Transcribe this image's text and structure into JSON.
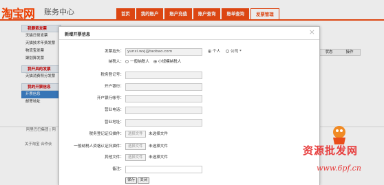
{
  "header": {
    "logo": "淘宝网",
    "subtitle": "账务中心",
    "tabs": [
      "首页",
      "我的账户",
      "账户充值",
      "账户查询",
      "账单查询",
      "发票管理"
    ],
    "active_tab": "发票管理"
  },
  "sidebar": {
    "sections": [
      {
        "title": "我要索发票",
        "items": [
          "天猫日常发票",
          "天猫技术年费发票",
          "物流宝发票",
          "聚划算发票"
        ]
      },
      {
        "title": "我开具的发票",
        "items": [
          "天猫消费积分发票"
        ]
      },
      {
        "title": "我的开票信息",
        "items": [
          "开票信息",
          "邮寄地址"
        ]
      }
    ],
    "active_item": "开票信息"
  },
  "table": {
    "headers": [
      "状态",
      "操作"
    ]
  },
  "footer": {
    "line1": "阿里巴巴集团 | 阿",
    "line2": "关于淘宝  合作伙"
  },
  "modal": {
    "title": "新增开票信息",
    "close": "×",
    "fields": {
      "invoice_header_label": "发票抬头：",
      "invoice_header_value": "yunxi.wxj@taobao.com",
      "personal_label": "个人",
      "company_label": "公司 *",
      "taxpayer_label": "纳税人：",
      "taxpayer_general": "一般纳税人",
      "taxpayer_small": "小规模纳税人",
      "tax_no_label": "税务登记号：",
      "bank_label": "开户银行：",
      "bank_account_label": "开户银行帐号：",
      "biz_phone_label": "营业电话：",
      "biz_address_label": "营业地址：",
      "tax_cert_label": "税务登记证扫描件：",
      "general_taxpayer_cert_label": "一般纳税人资格认证扫描件：",
      "other_file_label": "其他文件：",
      "remark_label": "备注："
    },
    "file_button": "选择文件",
    "no_file": "未选择文件",
    "save": "保存",
    "close_btn": "关闭"
  },
  "watermark": {
    "text1": "资源批发网",
    "text2": "www.6pf.cn"
  }
}
